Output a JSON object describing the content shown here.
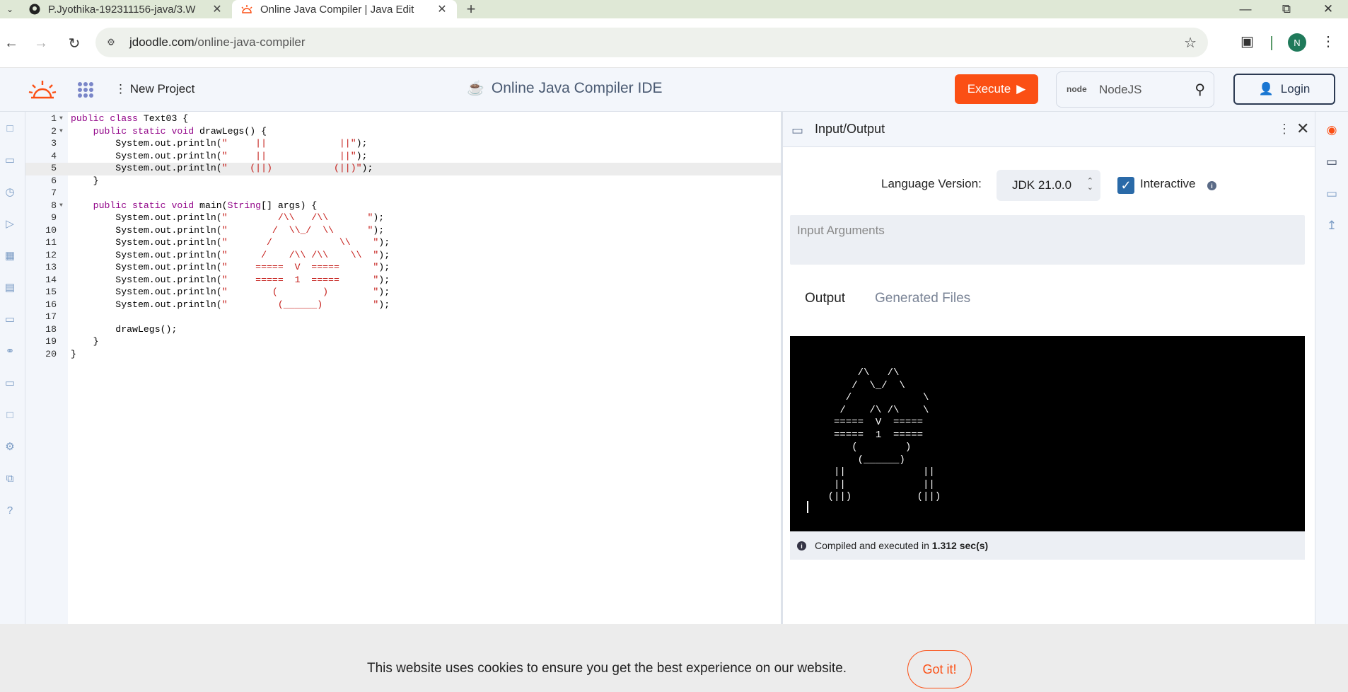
{
  "browser": {
    "tabs": [
      {
        "title": "P.Jyothika-192311156-java/3.W",
        "icon": "github-icon",
        "active": false
      },
      {
        "title": "Online Java Compiler | Java Edit",
        "icon": "jdoodle-icon",
        "active": true
      }
    ],
    "url_host": "jdoodle.com",
    "url_path": "/online-java-compiler",
    "profile_initial": "N"
  },
  "header": {
    "new_project": "New Project",
    "title": "Online Java Compiler IDE",
    "execute": "Execute",
    "language_search": "NodeJS",
    "language_badge": "node",
    "login": "Login",
    "accent_color": "#fb4f14"
  },
  "editor": {
    "highlighted_line": 5,
    "lines": [
      {
        "n": "1",
        "fold": true,
        "parts": [
          [
            "kw",
            "public class "
          ],
          [
            "",
            "Text03 {"
          ]
        ]
      },
      {
        "n": "2",
        "fold": true,
        "parts": [
          [
            "",
            "    "
          ],
          [
            "kw",
            "public static void "
          ],
          [
            "",
            "drawLegs() {"
          ]
        ]
      },
      {
        "n": "3",
        "fold": false,
        "parts": [
          [
            "",
            "        System.out.println("
          ],
          [
            "str",
            "\"     ||             ||\""
          ],
          [
            "",
            ");"
          ]
        ]
      },
      {
        "n": "4",
        "fold": false,
        "parts": [
          [
            "",
            "        System.out.println("
          ],
          [
            "str",
            "\"     ||             ||\""
          ],
          [
            "",
            ");"
          ]
        ]
      },
      {
        "n": "5",
        "fold": false,
        "parts": [
          [
            "",
            "        System.out.println("
          ],
          [
            "str",
            "\"    (||)           (||)\""
          ],
          [
            "",
            ");"
          ]
        ]
      },
      {
        "n": "6",
        "fold": false,
        "parts": [
          [
            "",
            "    }"
          ]
        ]
      },
      {
        "n": "7",
        "fold": false,
        "parts": [
          [
            "",
            ""
          ]
        ]
      },
      {
        "n": "8",
        "fold": true,
        "parts": [
          [
            "",
            "    "
          ],
          [
            "kw",
            "public static void "
          ],
          [
            "",
            "main("
          ],
          [
            "kw",
            "String"
          ],
          [
            "",
            "[] args) {"
          ]
        ]
      },
      {
        "n": "9",
        "fold": false,
        "parts": [
          [
            "",
            "        System.out.println("
          ],
          [
            "str",
            "\"         /\\\\   /\\\\       \""
          ],
          [
            "",
            ");"
          ]
        ]
      },
      {
        "n": "10",
        "fold": false,
        "parts": [
          [
            "",
            "        System.out.println("
          ],
          [
            "str",
            "\"        /  \\\\_/  \\\\      \""
          ],
          [
            "",
            ");"
          ]
        ]
      },
      {
        "n": "11",
        "fold": false,
        "parts": [
          [
            "",
            "        System.out.println("
          ],
          [
            "str",
            "\"       /            \\\\    \""
          ],
          [
            "",
            ");"
          ]
        ]
      },
      {
        "n": "12",
        "fold": false,
        "parts": [
          [
            "",
            "        System.out.println("
          ],
          [
            "str",
            "\"      /    /\\\\ /\\\\    \\\\  \""
          ],
          [
            "",
            ");"
          ]
        ]
      },
      {
        "n": "13",
        "fold": false,
        "parts": [
          [
            "",
            "        System.out.println("
          ],
          [
            "str",
            "\"     =====  V  =====      \""
          ],
          [
            "",
            ");"
          ]
        ]
      },
      {
        "n": "14",
        "fold": false,
        "parts": [
          [
            "",
            "        System.out.println("
          ],
          [
            "str",
            "\"     =====  1  =====      \""
          ],
          [
            "",
            ");"
          ]
        ]
      },
      {
        "n": "15",
        "fold": false,
        "parts": [
          [
            "",
            "        System.out.println("
          ],
          [
            "str",
            "\"        (        )        \""
          ],
          [
            "",
            ");"
          ]
        ]
      },
      {
        "n": "16",
        "fold": false,
        "parts": [
          [
            "",
            "        System.out.println("
          ],
          [
            "str",
            "\"         (______)         \""
          ],
          [
            "",
            ");"
          ]
        ]
      },
      {
        "n": "17",
        "fold": false,
        "parts": [
          [
            "",
            ""
          ]
        ]
      },
      {
        "n": "18",
        "fold": false,
        "parts": [
          [
            "",
            "        drawLegs();"
          ]
        ]
      },
      {
        "n": "19",
        "fold": false,
        "parts": [
          [
            "",
            "    }"
          ]
        ]
      },
      {
        "n": "20",
        "fold": false,
        "parts": [
          [
            "",
            "}"
          ]
        ]
      }
    ]
  },
  "io": {
    "title": "Input/Output",
    "language_version_label": "Language Version:",
    "language_version": "JDK 21.0.0",
    "interactive_label": "Interactive",
    "interactive_checked": true,
    "input_placeholder": "Input Arguments",
    "tab_output": "Output",
    "tab_generated": "Generated Files",
    "console_output": "         /\\   /\\       \n        /  \\_/  \\      \n       /            \\    \n      /    /\\ /\\    \\  \n     =====  V  =====      \n     =====  1  =====      \n        (        )        \n         (______)         \n     ||             ||\n     ||             ||\n    (||)           (||)",
    "status_prefix": "Compiled and executed in ",
    "status_time": "1.312 sec(s)"
  },
  "cookie": {
    "message": "This website uses cookies to ensure you get the best experience on our website.",
    "button": "Got it!"
  }
}
